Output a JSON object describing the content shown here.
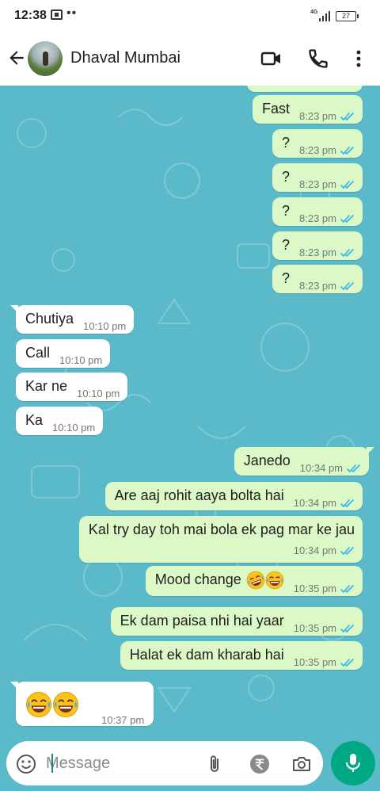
{
  "status_bar": {
    "time": "12:38",
    "dots": "••",
    "network": "4G",
    "battery": "27"
  },
  "header": {
    "contact_name": "Dhaval Mumbai",
    "icons": [
      "back-arrow-icon",
      "video-call-icon",
      "phone-icon",
      "more-vert-icon"
    ]
  },
  "messages": [
    {
      "dir": "out",
      "text": "Fast",
      "time": "8:23 pm",
      "read": true
    },
    {
      "dir": "out",
      "text": "?",
      "time": "8:23 pm",
      "read": true
    },
    {
      "dir": "out",
      "text": "?",
      "time": "8:23 pm",
      "read": true
    },
    {
      "dir": "out",
      "text": "?",
      "time": "8:23 pm",
      "read": true
    },
    {
      "dir": "out",
      "text": "?",
      "time": "8:23 pm",
      "read": true
    },
    {
      "dir": "out",
      "text": "?",
      "time": "8:23 pm",
      "read": true
    },
    {
      "dir": "in",
      "text": "Chutiya",
      "time": "10:10 pm"
    },
    {
      "dir": "in",
      "text": "Call",
      "time": "10:10 pm"
    },
    {
      "dir": "in",
      "text": "Kar ne",
      "time": "10:10 pm"
    },
    {
      "dir": "in",
      "text": "Ka",
      "time": "10:10 pm"
    },
    {
      "dir": "out",
      "text": "Janedo",
      "time": "10:34 pm",
      "read": true
    },
    {
      "dir": "out",
      "text": "Are aaj rohit aaya bolta hai",
      "time": "10:34 pm",
      "read": true
    },
    {
      "dir": "out",
      "text": "Kal try day toh mai bola ek pag mar ke jau",
      "time": "10:34 pm",
      "read": true
    },
    {
      "dir": "out",
      "text": "Mood change",
      "emojis": [
        "rolling-laugh-emoji",
        "tears-of-joy-emoji"
      ],
      "time": "10:35 pm",
      "read": true
    },
    {
      "dir": "out",
      "text": "Ek dam paisa nhi hai yaar",
      "time": "10:35 pm",
      "read": true
    },
    {
      "dir": "out",
      "text": "Halat ek dam kharab hai",
      "time": "10:35 pm",
      "read": true
    },
    {
      "dir": "in",
      "text": "",
      "emojis": [
        "tears-of-joy-emoji",
        "tears-of-joy-emoji"
      ],
      "time": "10:37 pm"
    }
  ],
  "input": {
    "placeholder": "Message",
    "value": ""
  },
  "colors": {
    "chat_bg": "#5bbac9",
    "outgoing_bubble": "#dcf8c6",
    "incoming_bubble": "#ffffff",
    "read_ticks": "#34b7f1",
    "mic_button": "#00a884"
  }
}
